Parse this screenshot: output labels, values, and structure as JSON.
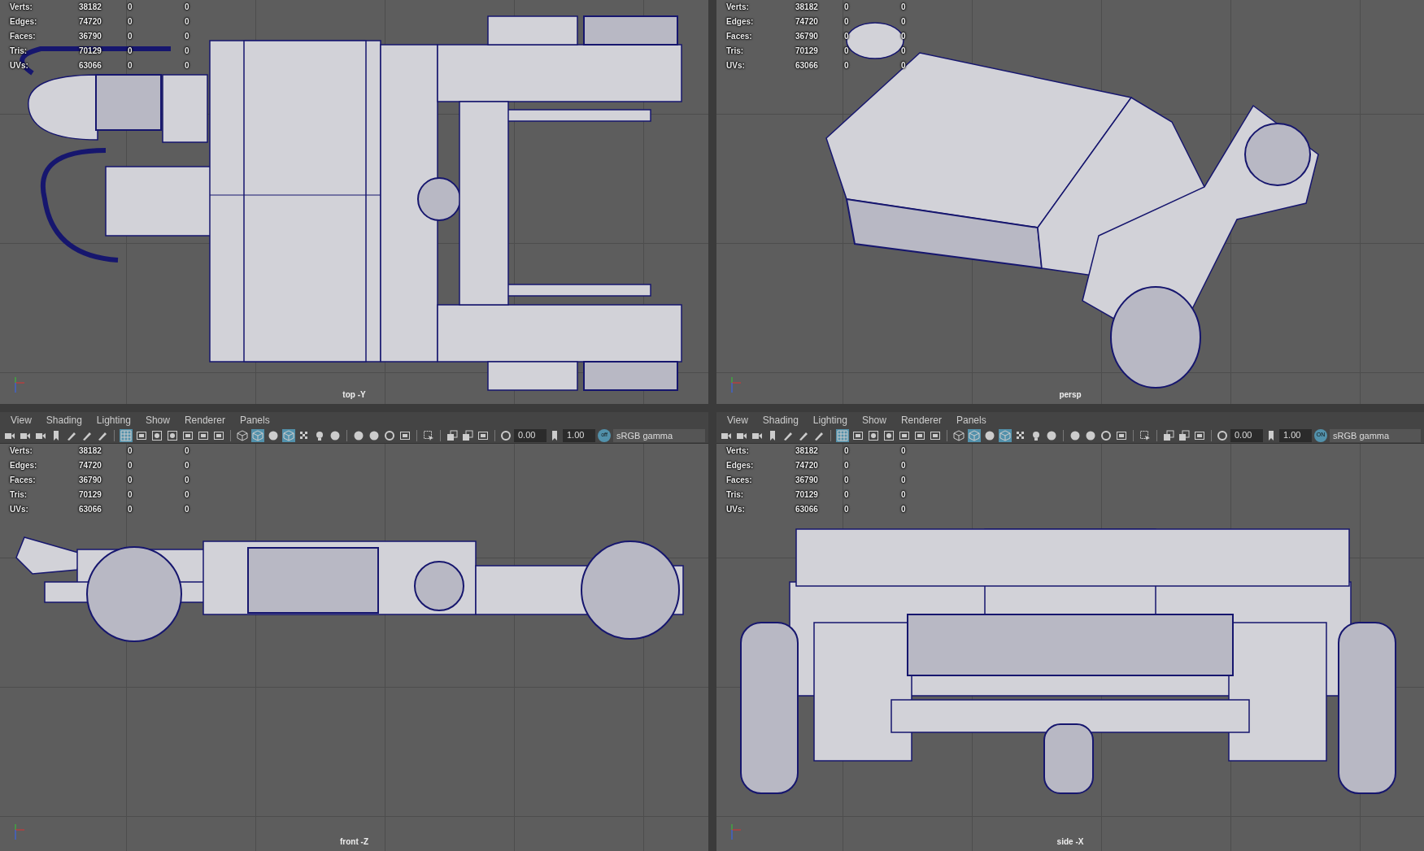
{
  "viewports": [
    {
      "kind": "top",
      "camera": "top -Y",
      "hud": [
        {
          "label": "Verts:",
          "value": "38182",
          "col_3": "0",
          "col_4": "0"
        },
        {
          "label": "Edges:",
          "value": "74720",
          "col_3": "0",
          "col_4": "0"
        },
        {
          "label": "Faces:",
          "value": "36790",
          "col_3": "0",
          "col_4": "0"
        },
        {
          "label": "Tris:",
          "value": "70129",
          "col_3": "0",
          "col_4": "0"
        },
        {
          "label": "UVs:",
          "value": "63066",
          "col_3": "0",
          "col_4": "0"
        }
      ]
    },
    {
      "kind": "persp",
      "camera": "persp",
      "hud": [
        {
          "label": "Verts:",
          "value": "38182",
          "col_3": "0",
          "col_4": "0"
        },
        {
          "label": "Edges:",
          "value": "74720",
          "col_3": "0",
          "col_4": "0"
        },
        {
          "label": "Faces:",
          "value": "36790",
          "col_3": "0",
          "col_4": "0"
        },
        {
          "label": "Tris:",
          "value": "70129",
          "col_3": "0",
          "col_4": "0"
        },
        {
          "label": "UVs:",
          "value": "63066",
          "col_3": "0",
          "col_4": "0"
        }
      ]
    },
    {
      "kind": "front",
      "camera": "front -Z",
      "menu": [
        "View",
        "Shading",
        "Lighting",
        "Show",
        "Renderer",
        "Panels"
      ],
      "toolbar": {
        "buttons": [
          {
            "kind": "camera",
            "selected": false
          },
          {
            "kind": "camera",
            "selected": false
          },
          {
            "kind": "camera",
            "selected": false
          },
          {
            "kind": "bookmark",
            "selected": false
          },
          {
            "kind": "tool",
            "selected": false
          },
          {
            "kind": "tool",
            "selected": false
          },
          {
            "kind": "tool",
            "selected": false
          },
          {
            "kind": "sep"
          },
          {
            "kind": "grid",
            "selected": true
          },
          {
            "kind": "frame",
            "selected": false
          },
          {
            "kind": "dot",
            "selected": false
          },
          {
            "kind": "dot",
            "selected": false
          },
          {
            "kind": "frame",
            "selected": false
          },
          {
            "kind": "frame",
            "selected": false
          },
          {
            "kind": "frame",
            "selected": false
          },
          {
            "kind": "sep"
          },
          {
            "kind": "cube",
            "selected": false
          },
          {
            "kind": "cube",
            "selected": true
          },
          {
            "kind": "sphere",
            "selected": false
          },
          {
            "kind": "cube",
            "selected": true
          },
          {
            "kind": "checker",
            "selected": false
          },
          {
            "kind": "bulb",
            "selected": false
          },
          {
            "kind": "sphere",
            "selected": false
          },
          {
            "kind": "sep"
          },
          {
            "kind": "sphere",
            "selected": false
          },
          {
            "kind": "sphere",
            "selected": false
          },
          {
            "kind": "ring",
            "selected": false
          },
          {
            "kind": "frame",
            "selected": false
          },
          {
            "kind": "sep"
          },
          {
            "kind": "select",
            "selected": false
          },
          {
            "kind": "sep"
          },
          {
            "kind": "stack",
            "selected": false
          },
          {
            "kind": "stack",
            "selected": false
          },
          {
            "kind": "frame",
            "selected": false
          },
          {
            "kind": "sep"
          }
        ],
        "exposure": "0.00",
        "gamma": "1.00",
        "cm_toggle": "off",
        "color_space": "sRGB gamma"
      },
      "hud": [
        {
          "label": "Verts:",
          "value": "38182",
          "col_3": "0",
          "col_4": "0"
        },
        {
          "label": "Edges:",
          "value": "74720",
          "col_3": "0",
          "col_4": "0"
        },
        {
          "label": "Faces:",
          "value": "36790",
          "col_3": "0",
          "col_4": "0"
        },
        {
          "label": "Tris:",
          "value": "70129",
          "col_3": "0",
          "col_4": "0"
        },
        {
          "label": "UVs:",
          "value": "63066",
          "col_3": "0",
          "col_4": "0"
        }
      ]
    },
    {
      "kind": "side",
      "camera": "side -X",
      "menu": [
        "View",
        "Shading",
        "Lighting",
        "Show",
        "Renderer",
        "Panels"
      ],
      "toolbar": {
        "buttons": [
          {
            "kind": "camera",
            "selected": false
          },
          {
            "kind": "camera",
            "selected": false
          },
          {
            "kind": "camera",
            "selected": false
          },
          {
            "kind": "bookmark",
            "selected": false
          },
          {
            "kind": "tool",
            "selected": false
          },
          {
            "kind": "tool",
            "selected": false
          },
          {
            "kind": "tool",
            "selected": false
          },
          {
            "kind": "sep"
          },
          {
            "kind": "grid",
            "selected": true
          },
          {
            "kind": "frame",
            "selected": false
          },
          {
            "kind": "dot",
            "selected": false
          },
          {
            "kind": "dot",
            "selected": false
          },
          {
            "kind": "frame",
            "selected": false
          },
          {
            "kind": "frame",
            "selected": false
          },
          {
            "kind": "frame",
            "selected": false
          },
          {
            "kind": "sep"
          },
          {
            "kind": "cube",
            "selected": false
          },
          {
            "kind": "cube",
            "selected": true
          },
          {
            "kind": "sphere",
            "selected": false
          },
          {
            "kind": "cube",
            "selected": true
          },
          {
            "kind": "checker",
            "selected": false
          },
          {
            "kind": "bulb",
            "selected": false
          },
          {
            "kind": "sphere",
            "selected": false
          },
          {
            "kind": "sep"
          },
          {
            "kind": "sphere",
            "selected": false
          },
          {
            "kind": "sphere",
            "selected": false
          },
          {
            "kind": "ring",
            "selected": false
          },
          {
            "kind": "frame",
            "selected": false
          },
          {
            "kind": "sep"
          },
          {
            "kind": "select",
            "selected": false
          },
          {
            "kind": "sep"
          },
          {
            "kind": "stack",
            "selected": false
          },
          {
            "kind": "stack",
            "selected": false
          },
          {
            "kind": "frame",
            "selected": false
          },
          {
            "kind": "sep"
          }
        ],
        "exposure": "0.00",
        "gamma": "1.00",
        "cm_toggle": "ON",
        "color_space": "sRGB gamma"
      },
      "hud": [
        {
          "label": "Verts:",
          "value": "38182",
          "col_3": "0",
          "col_4": "0"
        },
        {
          "label": "Edges:",
          "value": "74720",
          "col_3": "0",
          "col_4": "0"
        },
        {
          "label": "Faces:",
          "value": "36790",
          "col_3": "0",
          "col_4": "0"
        },
        {
          "label": "Tris:",
          "value": "70129",
          "col_3": "0",
          "col_4": "0"
        },
        {
          "label": "UVs:",
          "value": "63066",
          "col_3": "0",
          "col_4": "0"
        }
      ]
    }
  ]
}
